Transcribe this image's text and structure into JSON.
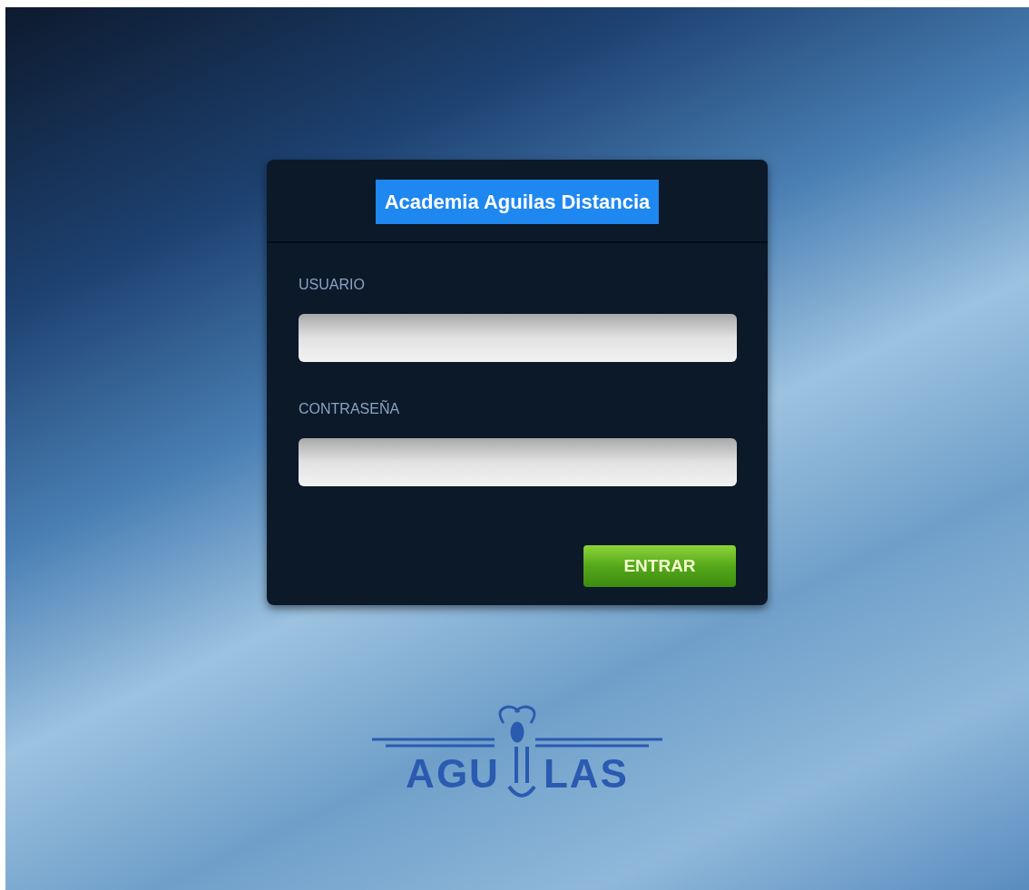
{
  "login": {
    "title": "Academia Aguilas Distancia",
    "fields": [
      {
        "label": "USUARIO"
      },
      {
        "label": "CONTRASEÑA"
      }
    ],
    "submit": "ENTRAR"
  },
  "logo": {
    "left": "AGU",
    "right": "LAS"
  }
}
